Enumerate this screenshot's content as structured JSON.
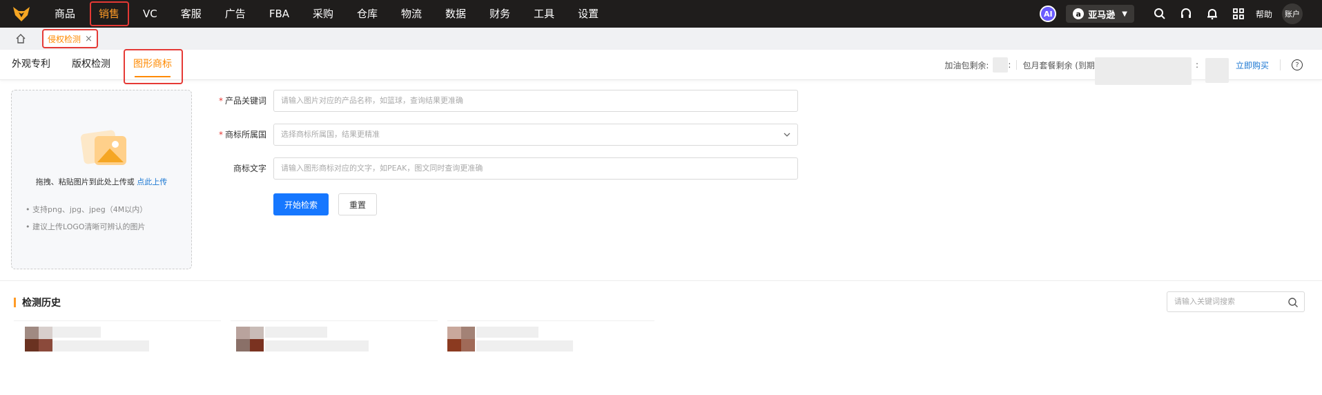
{
  "topnav": {
    "items": [
      {
        "label": "商品",
        "active": false
      },
      {
        "label": "销售",
        "active": true
      },
      {
        "label": "VC",
        "active": false
      },
      {
        "label": "客服",
        "active": false
      },
      {
        "label": "广告",
        "active": false
      },
      {
        "label": "FBA",
        "active": false
      },
      {
        "label": "采购",
        "active": false
      },
      {
        "label": "仓库",
        "active": false
      },
      {
        "label": "物流",
        "active": false
      },
      {
        "label": "数据",
        "active": false
      },
      {
        "label": "财务",
        "active": false
      },
      {
        "label": "工具",
        "active": false
      },
      {
        "label": "设置",
        "active": false
      }
    ],
    "ai_label": "AI",
    "store_label": "亚马逊",
    "help_label": "帮助",
    "account_label": "账户",
    "icons": [
      "search-icon",
      "headset-icon",
      "bell-icon",
      "apps-icon"
    ]
  },
  "tabbar": {
    "open_tab_label": "侵权检测",
    "close_glyph": "×"
  },
  "subtabs": {
    "items": [
      {
        "label": "外观专利",
        "active": false
      },
      {
        "label": "版权检测",
        "active": false
      },
      {
        "label": "图形商标",
        "active": true
      }
    ],
    "quota_addon_label": "加油包剩余:",
    "quota_monthly_label": "包月套餐剩余 (到期",
    "colon": ":",
    "buy_label": "立即购买",
    "help_glyph": "?"
  },
  "upload": {
    "hint_text": "拖拽、粘贴图片到此处上传或",
    "hint_link": "点此上传",
    "tips": [
      "• 支持png、jpg、jpeg（4M以内）",
      "• 建议上传LOGO清晰可辨认的图片"
    ]
  },
  "form": {
    "keyword_label": "产品关键词",
    "keyword_placeholder": "请输入图片对应的产品名称，如篮球，查询结果更准确",
    "country_label": "商标所属国",
    "country_placeholder": "选择商标所属国，结果更精准",
    "text_label": "商标文字",
    "text_placeholder": "请输入图形商标对应的文字，如PEAK，图文同时查询更准确",
    "required_mark": "*",
    "search_button": "开始检索",
    "reset_button": "重置"
  },
  "history": {
    "title": "检测历史",
    "search_placeholder": "请输入关键词搜索"
  },
  "colors": {
    "accent": "#ff8a00",
    "primary": "#1677ff",
    "highlight_box": "#e53935",
    "nav_bg": "#1f1d1c"
  }
}
